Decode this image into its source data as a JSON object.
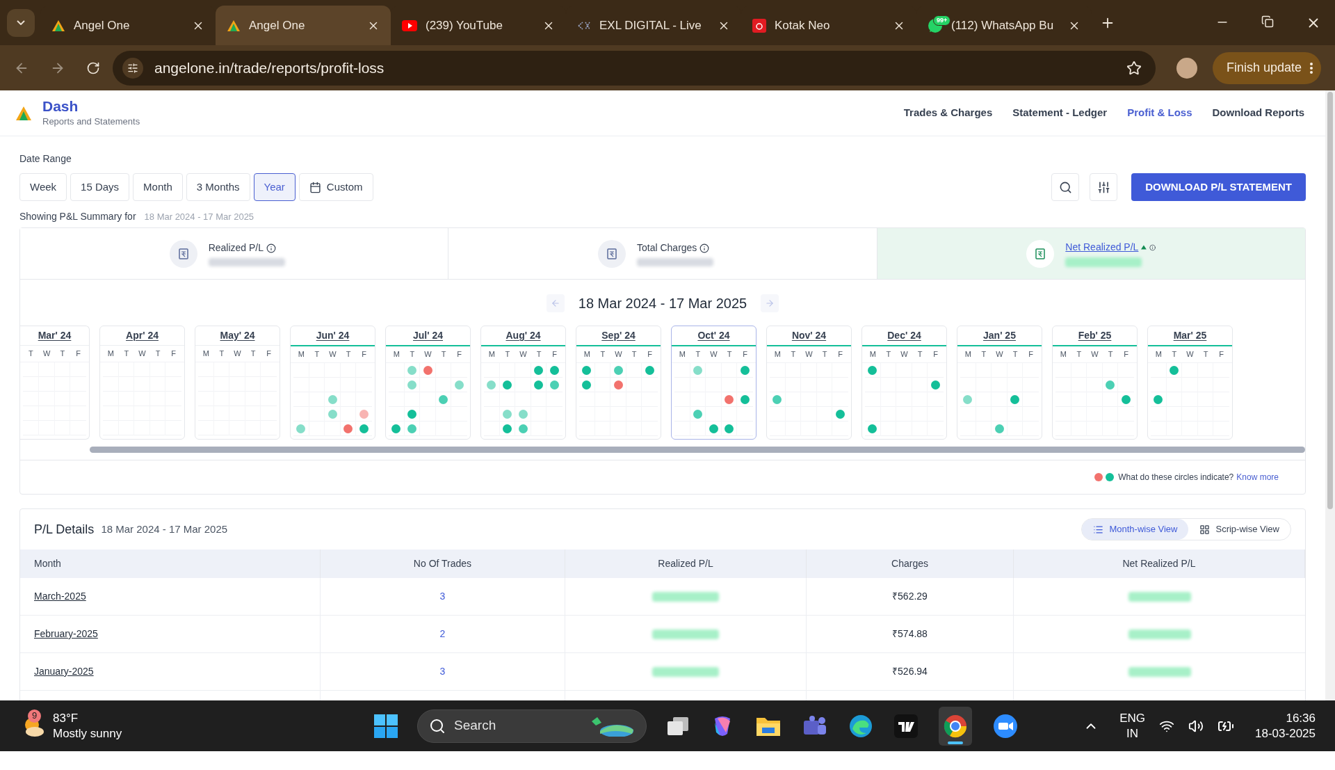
{
  "browser": {
    "tabs": [
      {
        "title": "Angel One",
        "kind": "triangle",
        "selected": false
      },
      {
        "title": "Angel One",
        "kind": "triangle",
        "selected": true
      },
      {
        "title": "(239) YouTube",
        "kind": "play",
        "selected": false
      },
      {
        "title": "EXL DIGITAL - Live",
        "kind": "dotted",
        "selected": false
      },
      {
        "title": "Kotak Neo",
        "kind": "square",
        "selected": false
      },
      {
        "title": "(112) WhatsApp Bu",
        "kind": "chat",
        "badge": "99+",
        "selected": false
      }
    ],
    "url": "angelone.in/trade/reports/profit-loss",
    "update_button": "Finish update"
  },
  "header": {
    "title": "Dash",
    "subtitle": "Reports and Statements",
    "nav": [
      {
        "label": "Trades & Charges",
        "selected": false
      },
      {
        "label": "Statement - Ledger",
        "selected": false
      },
      {
        "label": "Profit & Loss",
        "selected": true
      },
      {
        "label": "Download Reports",
        "selected": false
      }
    ]
  },
  "date_range": {
    "label": "Date Range",
    "options": [
      {
        "label": "Week",
        "selected": false
      },
      {
        "label": "15 Days",
        "selected": false
      },
      {
        "label": "Month",
        "selected": false
      },
      {
        "label": "3 Months",
        "selected": false
      },
      {
        "label": "Year",
        "selected": true
      },
      {
        "label": "Custom",
        "selected": false
      }
    ],
    "download_button": "DOWNLOAD P/L STATEMENT"
  },
  "summary": {
    "label": "Showing P&L Summary for",
    "period": "18 Mar 2024 - 17 Mar 2025",
    "cards": [
      {
        "label": "Realized P/L",
        "selected": false
      },
      {
        "label": "Total Charges",
        "selected": false
      },
      {
        "label": "Net Realized P/L",
        "selected": true
      }
    ]
  },
  "calendar": {
    "period": "18 Mar 2024 - 17 Mar 2025",
    "months": [
      {
        "label": "Mar' 24",
        "active": false,
        "selected": false,
        "weekdays": [
          "T",
          "W",
          "T",
          "F"
        ],
        "weeks": [
          {
            "days": [
              {
                "kind": "empty"
              },
              {
                "kind": "empty"
              },
              {
                "kind": "empty"
              },
              {
                "kind": "empty"
              }
            ]
          },
          {
            "days": [
              {
                "kind": "empty"
              },
              {
                "kind": "empty"
              },
              {
                "kind": "empty"
              },
              {
                "kind": "empty"
              }
            ]
          },
          {
            "days": [
              {
                "kind": "empty"
              },
              {
                "kind": "empty"
              },
              {
                "kind": "empty"
              },
              {
                "kind": "empty"
              }
            ]
          },
          {
            "days": [
              {
                "kind": "empty"
              },
              {
                "kind": "empty"
              },
              {
                "kind": "empty"
              },
              {
                "kind": "empty"
              }
            ]
          },
          {
            "days": [
              {
                "kind": "empty"
              },
              {
                "kind": "empty"
              },
              {
                "kind": "empty"
              },
              {
                "kind": "empty"
              }
            ]
          }
        ]
      },
      {
        "label": "Apr' 24",
        "active": false,
        "selected": false,
        "weekdays": [
          "M",
          "T",
          "W",
          "T",
          "F"
        ],
        "weeks": [
          {
            "days": [
              {
                "kind": "empty"
              },
              {
                "kind": "empty"
              },
              {
                "kind": "empty"
              },
              {
                "kind": "empty"
              },
              {
                "kind": "empty"
              }
            ]
          },
          {
            "days": [
              {
                "kind": "empty"
              },
              {
                "kind": "empty"
              },
              {
                "kind": "empty"
              },
              {
                "kind": "empty"
              },
              {
                "kind": "empty"
              }
            ]
          },
          {
            "days": [
              {
                "kind": "empty"
              },
              {
                "kind": "empty"
              },
              {
                "kind": "empty"
              },
              {
                "kind": "empty"
              },
              {
                "kind": "empty"
              }
            ]
          },
          {
            "days": [
              {
                "kind": "empty"
              },
              {
                "kind": "empty"
              },
              {
                "kind": "empty"
              },
              {
                "kind": "empty"
              },
              {
                "kind": "empty"
              }
            ]
          },
          {
            "days": [
              {
                "kind": "empty"
              },
              {
                "kind": "empty"
              },
              {
                "kind": "empty"
              },
              {
                "kind": "empty"
              },
              {
                "kind": "empty"
              }
            ]
          }
        ]
      },
      {
        "label": "May' 24",
        "active": false,
        "selected": false,
        "weekdays": [
          "M",
          "T",
          "W",
          "T",
          "F"
        ],
        "weeks": [
          {
            "days": [
              {
                "kind": "empty"
              },
              {
                "kind": "empty"
              },
              {
                "kind": "empty"
              },
              {
                "kind": "empty"
              },
              {
                "kind": "empty"
              }
            ]
          },
          {
            "days": [
              {
                "kind": "empty"
              },
              {
                "kind": "empty"
              },
              {
                "kind": "empty"
              },
              {
                "kind": "empty"
              },
              {
                "kind": "empty"
              }
            ]
          },
          {
            "days": [
              {
                "kind": "empty"
              },
              {
                "kind": "empty"
              },
              {
                "kind": "empty"
              },
              {
                "kind": "empty"
              },
              {
                "kind": "empty"
              }
            ]
          },
          {
            "days": [
              {
                "kind": "empty"
              },
              {
                "kind": "empty"
              },
              {
                "kind": "empty"
              },
              {
                "kind": "empty"
              },
              {
                "kind": "empty"
              }
            ]
          },
          {
            "days": [
              {
                "kind": "empty"
              },
              {
                "kind": "empty"
              },
              {
                "kind": "empty"
              },
              {
                "kind": "empty"
              },
              {
                "kind": "empty"
              }
            ]
          }
        ]
      },
      {
        "label": "Jun' 24",
        "active": true,
        "selected": false,
        "weekdays": [
          "M",
          "T",
          "W",
          "T",
          "F"
        ],
        "weeks": [
          {
            "days": [
              {
                "kind": "empty"
              },
              {
                "kind": "empty"
              },
              {
                "kind": "empty"
              },
              {
                "kind": "empty"
              },
              {
                "kind": "empty"
              }
            ]
          },
          {
            "days": [
              {
                "kind": "empty"
              },
              {
                "kind": "empty"
              },
              {
                "kind": "empty"
              },
              {
                "kind": "empty"
              },
              {
                "kind": "empty"
              }
            ]
          },
          {
            "days": [
              {
                "kind": "empty"
              },
              {
                "kind": "empty"
              },
              {
                "kind": "trade",
                "color": "#86dec9"
              },
              {
                "kind": "empty"
              },
              {
                "kind": "empty"
              }
            ]
          },
          {
            "days": [
              {
                "kind": "empty"
              },
              {
                "kind": "empty"
              },
              {
                "kind": "trade",
                "color": "#86dec9"
              },
              {
                "kind": "empty"
              },
              {
                "kind": "trade",
                "color": "#f8b4b2"
              }
            ]
          },
          {
            "days": [
              {
                "kind": "trade",
                "color": "#86dec9"
              },
              {
                "kind": "empty"
              },
              {
                "kind": "empty"
              },
              {
                "kind": "trade",
                "color": "#f2726d"
              },
              {
                "kind": "trade",
                "color": "#14bf99"
              }
            ]
          }
        ]
      },
      {
        "label": "Jul' 24",
        "active": true,
        "selected": false,
        "weekdays": [
          "M",
          "T",
          "W",
          "T",
          "F"
        ],
        "weeks": [
          {
            "days": [
              {
                "kind": "empty"
              },
              {
                "kind": "trade",
                "color": "#86dec9"
              },
              {
                "kind": "trade",
                "color": "#f2726d"
              },
              {
                "kind": "empty"
              },
              {
                "kind": "empty"
              }
            ]
          },
          {
            "days": [
              {
                "kind": "empty"
              },
              {
                "kind": "trade",
                "color": "#86dec9"
              },
              {
                "kind": "empty"
              },
              {
                "kind": "empty"
              },
              {
                "kind": "trade",
                "color": "#86dec9"
              }
            ]
          },
          {
            "days": [
              {
                "kind": "empty"
              },
              {
                "kind": "empty"
              },
              {
                "kind": "empty"
              },
              {
                "kind": "trade",
                "color": "#4cd0b4"
              },
              {
                "kind": "empty"
              }
            ]
          },
          {
            "days": [
              {
                "kind": "empty"
              },
              {
                "kind": "trade",
                "color": "#14bf99"
              },
              {
                "kind": "empty"
              },
              {
                "kind": "empty"
              },
              {
                "kind": "empty"
              }
            ]
          },
          {
            "days": [
              {
                "kind": "trade",
                "color": "#14bf99"
              },
              {
                "kind": "trade",
                "color": "#4cd0b4"
              },
              {
                "kind": "empty"
              },
              {
                "kind": "empty"
              },
              {
                "kind": "empty"
              }
            ]
          }
        ]
      },
      {
        "label": "Aug' 24",
        "active": true,
        "selected": false,
        "weekdays": [
          "M",
          "T",
          "W",
          "T",
          "F"
        ],
        "weeks": [
          {
            "days": [
              {
                "kind": "empty"
              },
              {
                "kind": "empty"
              },
              {
                "kind": "empty"
              },
              {
                "kind": "trade",
                "color": "#14bf99"
              },
              {
                "kind": "trade",
                "color": "#14bf99"
              }
            ]
          },
          {
            "days": [
              {
                "kind": "trade",
                "color": "#86dec9"
              },
              {
                "kind": "trade",
                "color": "#14bf99"
              },
              {
                "kind": "empty"
              },
              {
                "kind": "trade",
                "color": "#14bf99"
              },
              {
                "kind": "trade",
                "color": "#4cd0b4"
              }
            ]
          },
          {
            "days": [
              {
                "kind": "empty"
              },
              {
                "kind": "empty"
              },
              {
                "kind": "empty"
              },
              {
                "kind": "empty"
              },
              {
                "kind": "empty"
              }
            ]
          },
          {
            "days": [
              {
                "kind": "empty"
              },
              {
                "kind": "trade",
                "color": "#86dec9"
              },
              {
                "kind": "trade",
                "color": "#86dec9"
              },
              {
                "kind": "empty"
              },
              {
                "kind": "empty"
              }
            ]
          },
          {
            "days": [
              {
                "kind": "empty"
              },
              {
                "kind": "trade",
                "color": "#14bf99"
              },
              {
                "kind": "trade",
                "color": "#4cd0b4"
              },
              {
                "kind": "empty"
              },
              {
                "kind": "empty"
              }
            ]
          }
        ]
      },
      {
        "label": "Sep' 24",
        "active": true,
        "selected": false,
        "weekdays": [
          "M",
          "T",
          "W",
          "T",
          "F"
        ],
        "weeks": [
          {
            "days": [
              {
                "kind": "trade",
                "color": "#14bf99"
              },
              {
                "kind": "empty"
              },
              {
                "kind": "trade",
                "color": "#4cd0b4"
              },
              {
                "kind": "empty"
              },
              {
                "kind": "trade",
                "color": "#14bf99"
              }
            ]
          },
          {
            "days": [
              {
                "kind": "trade",
                "color": "#14bf99"
              },
              {
                "kind": "empty"
              },
              {
                "kind": "trade",
                "color": "#f2726d"
              },
              {
                "kind": "empty"
              },
              {
                "kind": "empty"
              }
            ]
          },
          {
            "days": [
              {
                "kind": "empty"
              },
              {
                "kind": "empty"
              },
              {
                "kind": "empty"
              },
              {
                "kind": "empty"
              },
              {
                "kind": "empty"
              }
            ]
          },
          {
            "days": [
              {
                "kind": "empty"
              },
              {
                "kind": "empty"
              },
              {
                "kind": "empty"
              },
              {
                "kind": "empty"
              },
              {
                "kind": "empty"
              }
            ]
          },
          {
            "days": [
              {
                "kind": "empty"
              },
              {
                "kind": "empty"
              },
              {
                "kind": "empty"
              },
              {
                "kind": "empty"
              },
              {
                "kind": "empty"
              }
            ]
          }
        ]
      },
      {
        "label": "Oct' 24",
        "active": true,
        "selected": true,
        "weekdays": [
          "M",
          "T",
          "W",
          "T",
          "F"
        ],
        "weeks": [
          {
            "days": [
              {
                "kind": "empty"
              },
              {
                "kind": "trade",
                "color": "#86dec9"
              },
              {
                "kind": "empty"
              },
              {
                "kind": "empty"
              },
              {
                "kind": "trade",
                "color": "#14bf99"
              }
            ]
          },
          {
            "days": [
              {
                "kind": "empty"
              },
              {
                "kind": "empty"
              },
              {
                "kind": "empty"
              },
              {
                "kind": "empty"
              },
              {
                "kind": "empty"
              }
            ]
          },
          {
            "days": [
              {
                "kind": "empty"
              },
              {
                "kind": "empty"
              },
              {
                "kind": "empty"
              },
              {
                "kind": "trade",
                "color": "#f2726d"
              },
              {
                "kind": "trade",
                "color": "#14bf99"
              }
            ]
          },
          {
            "days": [
              {
                "kind": "empty"
              },
              {
                "kind": "trade",
                "color": "#4cd0b4"
              },
              {
                "kind": "empty"
              },
              {
                "kind": "empty"
              },
              {
                "kind": "empty"
              }
            ]
          },
          {
            "days": [
              {
                "kind": "empty"
              },
              {
                "kind": "empty"
              },
              {
                "kind": "trade",
                "color": "#14bf99"
              },
              {
                "kind": "trade",
                "color": "#14bf99"
              },
              {
                "kind": "empty"
              }
            ]
          }
        ]
      },
      {
        "label": "Nov' 24",
        "active": true,
        "selected": false,
        "weekdays": [
          "M",
          "T",
          "W",
          "T",
          "F"
        ],
        "weeks": [
          {
            "days": [
              {
                "kind": "empty"
              },
              {
                "kind": "empty"
              },
              {
                "kind": "empty"
              },
              {
                "kind": "empty"
              },
              {
                "kind": "empty"
              }
            ]
          },
          {
            "days": [
              {
                "kind": "empty"
              },
              {
                "kind": "empty"
              },
              {
                "kind": "empty"
              },
              {
                "kind": "empty"
              },
              {
                "kind": "empty"
              }
            ]
          },
          {
            "days": [
              {
                "kind": "trade",
                "color": "#4cd0b4"
              },
              {
                "kind": "empty"
              },
              {
                "kind": "empty"
              },
              {
                "kind": "empty"
              },
              {
                "kind": "empty"
              }
            ]
          },
          {
            "days": [
              {
                "kind": "empty"
              },
              {
                "kind": "empty"
              },
              {
                "kind": "empty"
              },
              {
                "kind": "empty"
              },
              {
                "kind": "trade",
                "color": "#14bf99"
              }
            ]
          },
          {
            "days": [
              {
                "kind": "empty"
              },
              {
                "kind": "empty"
              },
              {
                "kind": "empty"
              },
              {
                "kind": "empty"
              },
              {
                "kind": "empty"
              }
            ]
          }
        ]
      },
      {
        "label": "Dec' 24",
        "active": true,
        "selected": false,
        "weekdays": [
          "M",
          "T",
          "W",
          "T",
          "F"
        ],
        "weeks": [
          {
            "days": [
              {
                "kind": "trade",
                "color": "#14bf99"
              },
              {
                "kind": "empty"
              },
              {
                "kind": "empty"
              },
              {
                "kind": "empty"
              },
              {
                "kind": "empty"
              }
            ]
          },
          {
            "days": [
              {
                "kind": "empty"
              },
              {
                "kind": "empty"
              },
              {
                "kind": "empty"
              },
              {
                "kind": "empty"
              },
              {
                "kind": "trade",
                "color": "#14bf99"
              }
            ]
          },
          {
            "days": [
              {
                "kind": "empty"
              },
              {
                "kind": "empty"
              },
              {
                "kind": "empty"
              },
              {
                "kind": "empty"
              },
              {
                "kind": "empty"
              }
            ]
          },
          {
            "days": [
              {
                "kind": "empty"
              },
              {
                "kind": "empty"
              },
              {
                "kind": "empty"
              },
              {
                "kind": "empty"
              },
              {
                "kind": "empty"
              }
            ]
          },
          {
            "days": [
              {
                "kind": "trade",
                "color": "#14bf99"
              },
              {
                "kind": "empty"
              },
              {
                "kind": "empty"
              },
              {
                "kind": "empty"
              },
              {
                "kind": "empty"
              }
            ]
          }
        ]
      },
      {
        "label": "Jan' 25",
        "active": true,
        "selected": false,
        "weekdays": [
          "M",
          "T",
          "W",
          "T",
          "F"
        ],
        "weeks": [
          {
            "days": [
              {
                "kind": "empty"
              },
              {
                "kind": "empty"
              },
              {
                "kind": "empty"
              },
              {
                "kind": "empty"
              },
              {
                "kind": "empty"
              }
            ]
          },
          {
            "days": [
              {
                "kind": "empty"
              },
              {
                "kind": "empty"
              },
              {
                "kind": "empty"
              },
              {
                "kind": "empty"
              },
              {
                "kind": "empty"
              }
            ]
          },
          {
            "days": [
              {
                "kind": "trade",
                "color": "#86dec9"
              },
              {
                "kind": "empty"
              },
              {
                "kind": "empty"
              },
              {
                "kind": "trade",
                "color": "#14bf99"
              },
              {
                "kind": "empty"
              }
            ]
          },
          {
            "days": [
              {
                "kind": "empty"
              },
              {
                "kind": "empty"
              },
              {
                "kind": "empty"
              },
              {
                "kind": "empty"
              },
              {
                "kind": "empty"
              }
            ]
          },
          {
            "days": [
              {
                "kind": "empty"
              },
              {
                "kind": "empty"
              },
              {
                "kind": "trade",
                "color": "#4cd0b4"
              },
              {
                "kind": "empty"
              },
              {
                "kind": "empty"
              }
            ]
          }
        ]
      },
      {
        "label": "Feb' 25",
        "active": true,
        "selected": false,
        "weekdays": [
          "M",
          "T",
          "W",
          "T",
          "F"
        ],
        "weeks": [
          {
            "days": [
              {
                "kind": "empty"
              },
              {
                "kind": "empty"
              },
              {
                "kind": "empty"
              },
              {
                "kind": "empty"
              },
              {
                "kind": "empty"
              }
            ]
          },
          {
            "days": [
              {
                "kind": "empty"
              },
              {
                "kind": "empty"
              },
              {
                "kind": "empty"
              },
              {
                "kind": "trade",
                "color": "#4cd0b4"
              },
              {
                "kind": "empty"
              }
            ]
          },
          {
            "days": [
              {
                "kind": "empty"
              },
              {
                "kind": "empty"
              },
              {
                "kind": "empty"
              },
              {
                "kind": "empty"
              },
              {
                "kind": "trade",
                "color": "#14bf99"
              }
            ]
          },
          {
            "days": [
              {
                "kind": "empty"
              },
              {
                "kind": "empty"
              },
              {
                "kind": "empty"
              },
              {
                "kind": "empty"
              },
              {
                "kind": "empty"
              }
            ]
          },
          {
            "days": [
              {
                "kind": "empty"
              },
              {
                "kind": "empty"
              },
              {
                "kind": "empty"
              },
              {
                "kind": "empty"
              },
              {
                "kind": "empty"
              }
            ]
          }
        ]
      },
      {
        "label": "Mar' 25",
        "active": true,
        "selected": false,
        "weekdays": [
          "M",
          "T",
          "W",
          "T",
          "F"
        ],
        "weeks": [
          {
            "days": [
              {
                "kind": "empty"
              },
              {
                "kind": "trade",
                "color": "#14bf99"
              },
              {
                "kind": "empty"
              },
              {
                "kind": "empty"
              },
              {
                "kind": "empty"
              }
            ]
          },
          {
            "days": [
              {
                "kind": "empty"
              },
              {
                "kind": "empty"
              },
              {
                "kind": "empty"
              },
              {
                "kind": "empty"
              },
              {
                "kind": "empty"
              }
            ]
          },
          {
            "days": [
              {
                "kind": "trade",
                "color": "#14bf99"
              },
              {
                "kind": "empty"
              },
              {
                "kind": "empty"
              },
              {
                "kind": "empty"
              },
              {
                "kind": "empty"
              }
            ]
          },
          {
            "days": [
              {
                "kind": "empty"
              },
              {
                "kind": "empty"
              },
              {
                "kind": "empty"
              },
              {
                "kind": "empty"
              },
              {
                "kind": "empty"
              }
            ]
          },
          {
            "days": [
              {
                "kind": "empty"
              },
              {
                "kind": "empty"
              },
              {
                "kind": "empty"
              },
              {
                "kind": "empty"
              },
              {
                "kind": "empty"
              }
            ]
          }
        ]
      }
    ],
    "legend": {
      "dots": [
        {
          "color": "#f2726d"
        },
        {
          "color": "#14bf99"
        }
      ],
      "text": "What do these circles indicate?",
      "link": "Know more"
    }
  },
  "details": {
    "title": "P/L Details",
    "period": "18 Mar 2024 - 17 Mar 2025",
    "views": [
      {
        "label": "Month-wise View",
        "selected": true
      },
      {
        "label": "Scrip-wise View",
        "selected": false
      }
    ],
    "columns": [
      "Month",
      "No Of Trades",
      "Realized P/L",
      "Charges",
      "Net Realized P/L"
    ],
    "rows": [
      {
        "month": "March-2025",
        "trades": "3",
        "charges": "₹562.29"
      },
      {
        "month": "February-2025",
        "trades": "2",
        "charges": "₹574.88"
      },
      {
        "month": "January-2025",
        "trades": "3",
        "charges": "₹526.94"
      }
    ]
  },
  "taskbar": {
    "weather_badge": "9",
    "temperature": "83°F",
    "weather": "Mostly sunny",
    "search": "Search",
    "language": "ENG",
    "region": "IN",
    "time": "16:36",
    "date": "18-03-2025"
  }
}
